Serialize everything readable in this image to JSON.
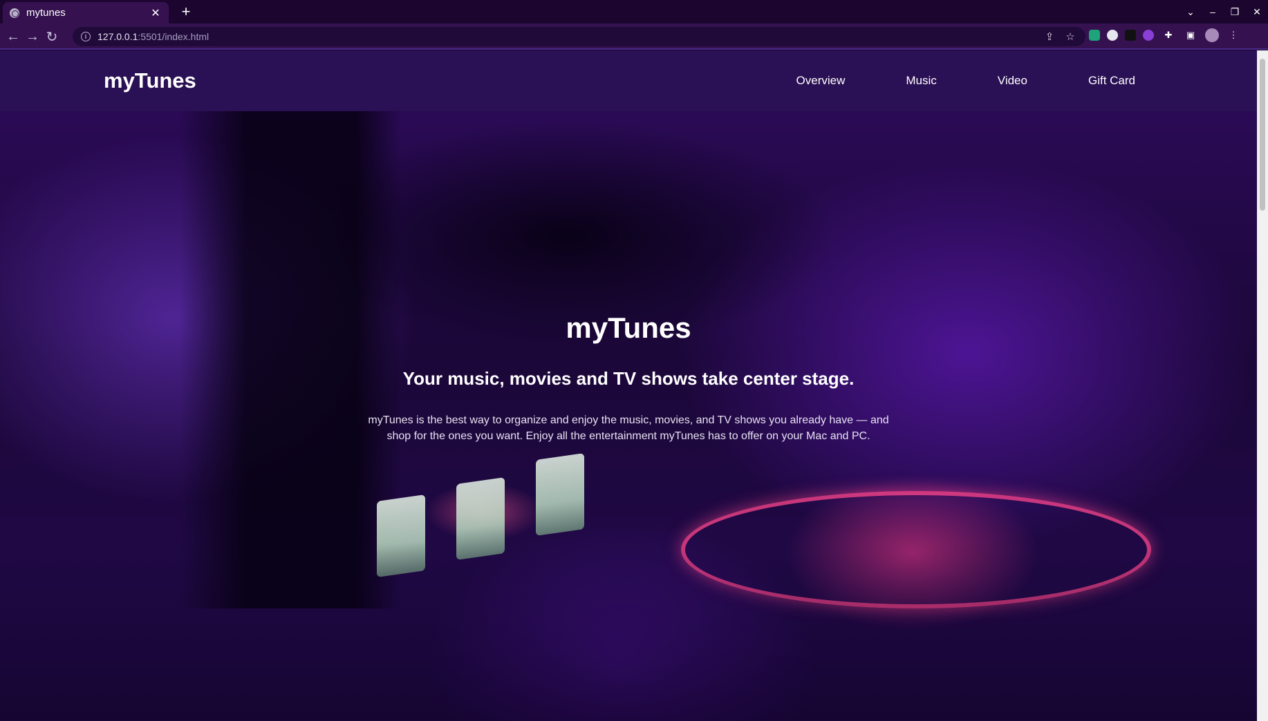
{
  "browser": {
    "tab_title": "mytunes",
    "url_host": "127.0.0.1",
    "url_rest": ":5501/index.html",
    "tab_close_glyph": "✕",
    "new_tab_glyph": "+"
  },
  "site": {
    "logo": "myTunes",
    "nav": [
      {
        "label": "Overview"
      },
      {
        "label": "Music"
      },
      {
        "label": "Video"
      },
      {
        "label": "Gift Card"
      }
    ]
  },
  "hero": {
    "title": "myTunes",
    "subtitle": "Your music, movies and TV shows take center stage.",
    "text": "myTunes is the best way to organize and enjoy the music, movies, and TV shows you already have — and shop for the ones you want. Enjoy all the entertainment myTunes has to offer on your Mac and PC."
  },
  "colors": {
    "header_bg": "#2a1054",
    "chrome_bg": "#35124f",
    "accent_pink": "#ff468c"
  },
  "icons": [
    "globe-icon",
    "close-icon",
    "plus-icon",
    "back-icon",
    "forward-icon",
    "reload-icon",
    "info-icon",
    "share-icon",
    "star-icon",
    "extensions-icon",
    "sidepanel-icon",
    "avatar",
    "menu-icon",
    "chevron-down-icon",
    "minimize-icon",
    "maximize-icon",
    "window-close-icon"
  ]
}
